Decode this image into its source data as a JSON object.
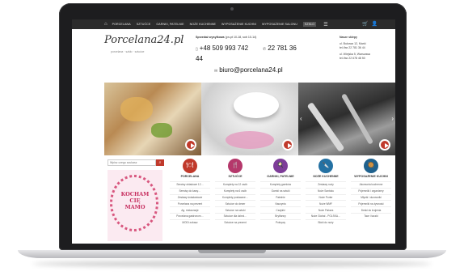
{
  "nav": {
    "home_icon": "home-icon",
    "items": [
      "PORCELANA",
      "SZTUĆCE",
      "GARNKI, PATELNIE",
      "NOŻE KUCHENNE",
      "WYPOSAŻENIE KUCHNI",
      "WYPOSAŻENIE SALONU",
      "SZKŁO"
    ],
    "active_index": 6,
    "menu_icon": "menu-icon",
    "cart_icon": "cart-icon",
    "user_icon": "user-icon"
  },
  "header": {
    "logo_text": "Porcelana24.pl",
    "logo_tagline": "porcelana · szkło · sztućce",
    "hours_label": "Sprzedaż wysyłkowa",
    "hours_text": "(pn-pt 10-18, sob 10-14)",
    "phone_mobile": "+48 509 993 742 44",
    "phone_landline": "22 781 36",
    "email": "biuro@porcelana24.pl",
    "stores_title": "Nasze sklepy",
    "stores": [
      "ul. Bukowa 12, Marki",
      "tel./fax 22 781 36 44",
      "ul. Wiejska 5, Warszawa",
      "tel./fax 22 678 48 50"
    ]
  },
  "banners": [
    {
      "name": "banner-breakfast"
    },
    {
      "name": "banner-porcelain-cups"
    },
    {
      "name": "banner-cutlery"
    }
  ],
  "search": {
    "placeholder": "Wpisz czego szukasz"
  },
  "promo": {
    "line1": "KOCHAM",
    "line2": "CIĘ",
    "line3": "MAMO"
  },
  "categories": [
    {
      "title": "PORCELANA",
      "color": "#c0392b",
      "items": [
        "Serwisy obiadowe 12…",
        "Serwisy do kawy…",
        "Zestawy śniadaniowe",
        "Porcelana na prezent",
        "Ag. restauracje",
        "Porcelana gastronom…",
        "MODI zobacz"
      ]
    },
    {
      "title": "SZTUĆCE",
      "color": "#b5386b",
      "items": [
        "Komplety na 12 osób",
        "Komplety na 6 osób",
        "Komplety pozłacane…",
        "Sztućce do deser",
        "Sztućce na sztuki",
        "Sztućce dla dzieci…",
        "Sztućce na prezent"
      ]
    },
    {
      "title": "GARNKI, PATELNIE",
      "color": "#7d3c98",
      "items": [
        "Komplety garnków",
        "Garnki na sztuki",
        "Patelnie",
        "Naczynia",
        "Czajniki",
        "Brytfanny",
        "Pokrywy"
      ]
    },
    {
      "title": "NOŻE KUCHENNE",
      "color": "#2471a3",
      "items": [
        "Zestawy noży",
        "Noże Santoku",
        "Noże Porter",
        "Noże WMF",
        "Noże Fiskars",
        "Noże Global - POLSKA…",
        "Bloki do noży"
      ]
    },
    {
      "title": "WYPOSAŻENIE KUCHNI",
      "color": "#1f618d",
      "items": [
        "Akcesoria kuchenne",
        "Pojemniki i organizery",
        "Młynki i dozowniki",
        "Pojemniki na żywność",
        "Deski do krojenia",
        "Tace i taczki"
      ]
    }
  ]
}
